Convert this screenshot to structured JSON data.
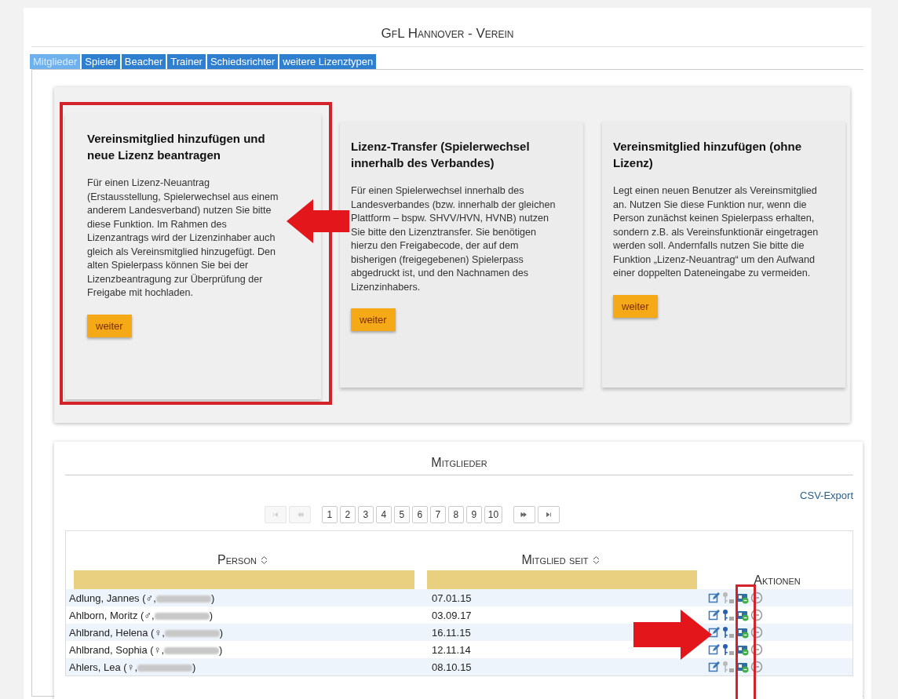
{
  "title": "GfL Hannover - Verein",
  "tabs": [
    {
      "label": "Mitglieder",
      "selected": true
    },
    {
      "label": "Spieler",
      "selected": false
    },
    {
      "label": "Beacher",
      "selected": false
    },
    {
      "label": "Trainer",
      "selected": false
    },
    {
      "label": "Schiedsrichter",
      "selected": false
    },
    {
      "label": "weitere Lizenztypen",
      "selected": false
    }
  ],
  "cards": [
    {
      "title": "Vereinsmitglied hinzufügen und neue Lizenz beantragen",
      "text": "Für einen Lizenz-Neuantrag (Erstausstellung, Spielerwechsel aus einem anderem Landesverband) nutzen Sie bitte diese Funktion. Im Rahmen des Lizenzantrags wird der Lizenzinhaber auch gleich als Vereinsmitglied hinzugefügt. Den alten Spielerpass können Sie bei der Lizenzbeantragung zur Überprüfung der Freigabe mit hochladen.",
      "button": "weiter",
      "highlighted": true,
      "arrow": false
    },
    {
      "title": "Lizenz-Transfer (Spielerwechsel innerhalb des Verbandes)",
      "text": "Für einen Spielerwechsel innerhalb des Landesverbandes (bzw. innerhalb der gleichen Plattform – bspw. SHVV/HVN, HVNB) nutzen Sie bitte den Lizenztransfer. Sie benötigen hierzu den Freigabecode, der auf dem bisherigen (freigegebenen) Spielerpass abgedruckt ist, und den Nachnamen des Lizenzinhabers.",
      "button": "weiter",
      "highlighted": false,
      "arrow": true
    },
    {
      "title": "Vereinsmitglied hinzufügen (ohne Lizenz)",
      "text": "Legt einen neuen Benutzer als Vereinsmitglied an. Nutzen Sie diese Funktion nur, wenn die Person zunächst keinen Spielerpass erhalten, sondern z.B. als Vereinsfunktionär eingetragen werden soll. Andernfalls nutzen Sie bitte die Funktion „Lizenz-Neuantrag“ um den Aufwand einer doppelten Dateneingabe zu vermeiden.",
      "button": "weiter",
      "highlighted": false,
      "arrow": false
    }
  ],
  "members": {
    "title": "Mitglieder",
    "export": "CSV-Export",
    "pager": {
      "nav": [
        {
          "kind": "first",
          "disabled": true
        },
        {
          "kind": "prev",
          "disabled": true
        },
        {
          "kind": "next",
          "disabled": false
        },
        {
          "kind": "last",
          "disabled": false
        }
      ],
      "pages": [
        "1",
        "2",
        "3",
        "4",
        "5",
        "6",
        "7",
        "8",
        "9",
        "10"
      ]
    },
    "columns": [
      "Person",
      "Mitglied seit",
      "Aktionen"
    ],
    "rows": [
      {
        "person": "Adlung, Jannes (♂,",
        "person_end": ")",
        "since": "07.01.15",
        "key_active": false
      },
      {
        "person": "Ahlborn, Moritz (♂,",
        "person_end": ")",
        "since": "03.09.17",
        "key_active": true
      },
      {
        "person": "Ahlbrand, Helena (♀,",
        "person_end": ")",
        "since": "16.11.15",
        "key_active": true
      },
      {
        "person": "Ahlbrand, Sophia (♀,",
        "person_end": ")",
        "since": "12.11.14",
        "key_active": true
      },
      {
        "person": "Ahlers, Lea (♀,",
        "person_end": ")",
        "since": "08.10.15",
        "key_active": false
      }
    ],
    "rows_arrow": true,
    "actions_highlight": true
  }
}
